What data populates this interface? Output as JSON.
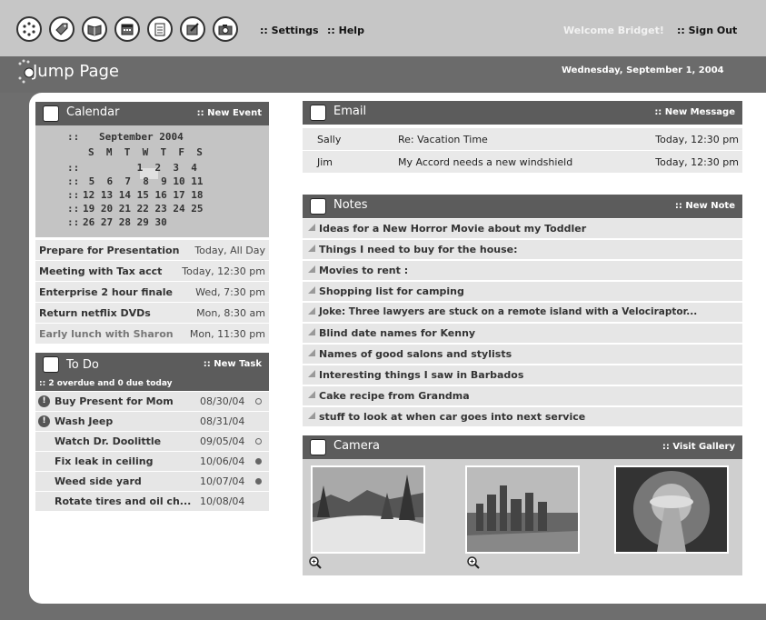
{
  "toolbar": {
    "icons": [
      "dots-icon",
      "tag-icon",
      "book-icon",
      "calendar-icon",
      "notebook-icon",
      "notes-icon",
      "camera-icon"
    ],
    "settings_label": ":: Settings",
    "help_label": ":: Help",
    "welcome": "Welcome Bridget!",
    "signout_label": ":: Sign Out"
  },
  "header": {
    "title": "Jump Page",
    "date": "Wednesday, September 1, 2004"
  },
  "calendar": {
    "title": "Calendar",
    "action": ":: New Event",
    "month": "September 2004",
    "weekdays": "S  M  T  W  T  F  S",
    "weeks": [
      "         1  2  3  4",
      " 5  6  7  8  9 10 11",
      "12 13 14 15 16 17 18",
      "19 20 21 22 23 24 25",
      "26 27 28 29 30"
    ],
    "events": [
      {
        "title": "Prepare for Presentation",
        "when": "Today, All Day"
      },
      {
        "title": "Meeting with Tax acct",
        "when": "Today, 12:30 pm"
      },
      {
        "title": "Enterprise 2 hour finale",
        "when": "Wed, 7:30 pm"
      },
      {
        "title": "Return netflix DVDs",
        "when": "Mon, 8:30 am"
      },
      {
        "title": "Early lunch with Sharon",
        "when": "Mon, 11:30 pm"
      }
    ]
  },
  "todo": {
    "title": "To Do",
    "action": ":: New Task",
    "summary": ":: 2 overdue and 0 due today",
    "items": [
      {
        "title": "Buy Present for Mom",
        "date": "08/30/04",
        "overdue": true,
        "dot": "empty"
      },
      {
        "title": "Wash Jeep",
        "date": "08/31/04",
        "overdue": true,
        "dot": "none"
      },
      {
        "title": "Watch Dr. Doolittle",
        "date": "09/05/04",
        "overdue": false,
        "dot": "empty"
      },
      {
        "title": "Fix leak in ceiling",
        "date": "10/06/04",
        "overdue": false,
        "dot": "filled"
      },
      {
        "title": "Weed side yard",
        "date": "10/07/04",
        "overdue": false,
        "dot": "filled"
      },
      {
        "title": "Rotate tires and oil ch...",
        "date": "10/08/04",
        "overdue": false,
        "dot": "none"
      }
    ]
  },
  "email": {
    "title": "Email",
    "action": ":: New Message",
    "messages": [
      {
        "from": "Sally",
        "subject": "Re: Vacation Time",
        "date": "Today, 12:30 pm"
      },
      {
        "from": "Jim",
        "subject": "My Accord needs a new windshield",
        "date": "Today, 12:30 pm"
      }
    ]
  },
  "notes": {
    "title": "Notes",
    "action": ":: New Note",
    "items": [
      "Ideas for a New Horror Movie about my Toddler",
      "Things I need to buy for the house:",
      "Movies to rent :",
      "Shopping list for camping",
      "Joke: Three lawyers are stuck on a remote island with a  Velociraptor...",
      "Blind date names for Kenny",
      "Names of good salons and stylists",
      "Interesting things I saw in Barbados",
      "Cake recipe from Grandma",
      "stuff to look at when car goes into next service"
    ]
  },
  "camera": {
    "title": "Camera",
    "action": ":: Visit Gallery"
  },
  "colors": {
    "dark_bar": "#5c5c5c",
    "toolbar": "#c6c6c6",
    "row": "#e6e6e6"
  }
}
